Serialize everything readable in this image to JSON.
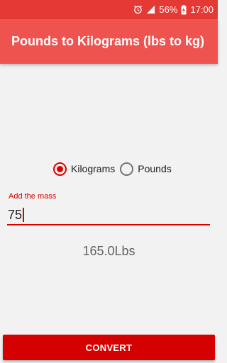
{
  "status_bar": {
    "battery_percent": "56%",
    "time": "17:00",
    "icons": [
      "alarm-icon",
      "signal-icon",
      "battery-charging-icon"
    ]
  },
  "app_bar": {
    "title": "Pounds to Kilograms (lbs to kg)"
  },
  "unit_selector": {
    "options": [
      {
        "label": "Kilograms",
        "selected": true
      },
      {
        "label": "Pounds",
        "selected": false
      }
    ]
  },
  "mass_field": {
    "label": "Add the mass",
    "value": "75"
  },
  "result": {
    "text": "165.0Lbs"
  },
  "actions": {
    "convert_label": "CONVERT"
  },
  "colors": {
    "status_bar": "#e53935",
    "app_bar": "#ef5350",
    "accent": "#d50000",
    "background": "#f2f2f2"
  }
}
